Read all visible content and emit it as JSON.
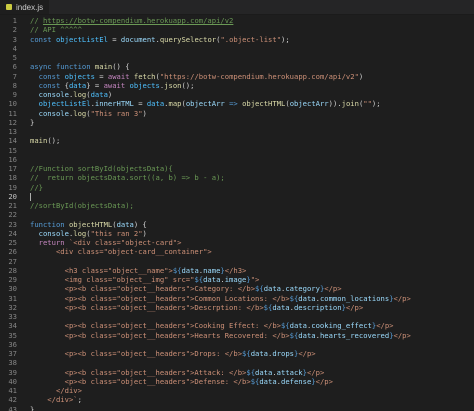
{
  "tab": {
    "filename": "index.js"
  },
  "lines": [
    {
      "n": "1",
      "t": [
        [
          "t-com",
          "// "
        ],
        [
          "t-link",
          "https://botw-compendium.herokuapp.com/api/v2"
        ]
      ]
    },
    {
      "n": "2",
      "t": [
        [
          "t-com",
          "// API ^^^^^"
        ]
      ]
    },
    {
      "n": "3",
      "t": [
        [
          "t-kw",
          "const "
        ],
        [
          "t-const",
          "objectListEl"
        ],
        [
          "t-op",
          " = "
        ],
        [
          "t-var",
          "document"
        ],
        [
          "t-op",
          "."
        ],
        [
          "t-fn",
          "querySelector"
        ],
        [
          "t-op",
          "("
        ],
        [
          "t-str",
          "\".object-list\""
        ],
        [
          "t-op",
          ");"
        ]
      ]
    },
    {
      "n": "4",
      "t": []
    },
    {
      "n": "5",
      "t": []
    },
    {
      "n": "6",
      "t": [
        [
          "t-kw",
          "async "
        ],
        [
          "t-kw",
          "function "
        ],
        [
          "t-fn",
          "main"
        ],
        [
          "t-op",
          "() {"
        ]
      ]
    },
    {
      "n": "7",
      "t": [
        [
          "t-op",
          "  "
        ],
        [
          "t-kw",
          "const "
        ],
        [
          "t-const",
          "objects"
        ],
        [
          "t-op",
          " = "
        ],
        [
          "t-ctrl",
          "await "
        ],
        [
          "t-fn",
          "fetch"
        ],
        [
          "t-op",
          "("
        ],
        [
          "t-str",
          "\"https://botw-compendium.herokuapp.com/api/v2\""
        ],
        [
          "t-op",
          ")"
        ]
      ]
    },
    {
      "n": "8",
      "t": [
        [
          "t-op",
          "  "
        ],
        [
          "t-kw",
          "const "
        ],
        [
          "t-op",
          "{"
        ],
        [
          "t-const",
          "data"
        ],
        [
          "t-op",
          "} = "
        ],
        [
          "t-ctrl",
          "await "
        ],
        [
          "t-const",
          "objects"
        ],
        [
          "t-op",
          "."
        ],
        [
          "t-fn",
          "json"
        ],
        [
          "t-op",
          "();"
        ]
      ]
    },
    {
      "n": "9",
      "t": [
        [
          "t-op",
          "  "
        ],
        [
          "t-var",
          "console"
        ],
        [
          "t-op",
          "."
        ],
        [
          "t-fn",
          "log"
        ],
        [
          "t-op",
          "("
        ],
        [
          "t-const",
          "data"
        ],
        [
          "t-op",
          ")"
        ]
      ]
    },
    {
      "n": "10",
      "t": [
        [
          "t-op",
          "  "
        ],
        [
          "t-const",
          "objectListEl"
        ],
        [
          "t-op",
          "."
        ],
        [
          "t-var",
          "innerHTML"
        ],
        [
          "t-op",
          " = "
        ],
        [
          "t-const",
          "data"
        ],
        [
          "t-op",
          "."
        ],
        [
          "t-fn",
          "map"
        ],
        [
          "t-op",
          "("
        ],
        [
          "t-var",
          "objectArr"
        ],
        [
          "t-kw",
          " => "
        ],
        [
          "t-fn",
          "objectHTML"
        ],
        [
          "t-op",
          "("
        ],
        [
          "t-var",
          "objectArr"
        ],
        [
          "t-op",
          "))."
        ],
        [
          "t-fn",
          "join"
        ],
        [
          "t-op",
          "("
        ],
        [
          "t-str",
          "\"\""
        ],
        [
          "t-op",
          ");"
        ]
      ]
    },
    {
      "n": "11",
      "t": [
        [
          "t-op",
          "  "
        ],
        [
          "t-var",
          "console"
        ],
        [
          "t-op",
          "."
        ],
        [
          "t-fn",
          "log"
        ],
        [
          "t-op",
          "("
        ],
        [
          "t-str",
          "\"This ran 3\""
        ],
        [
          "t-op",
          ")"
        ]
      ]
    },
    {
      "n": "12",
      "t": [
        [
          "t-op",
          "}"
        ]
      ]
    },
    {
      "n": "13",
      "t": []
    },
    {
      "n": "14",
      "t": [
        [
          "t-fn",
          "main"
        ],
        [
          "t-op",
          "();"
        ]
      ]
    },
    {
      "n": "15",
      "t": []
    },
    {
      "n": "16",
      "t": []
    },
    {
      "n": "17",
      "t": [
        [
          "t-com",
          "//Function sortById(objectsData){"
        ]
      ]
    },
    {
      "n": "18",
      "t": [
        [
          "t-com",
          "//  return objectsData.sort((a, b) => b - a);"
        ]
      ]
    },
    {
      "n": "19",
      "t": [
        [
          "t-com",
          "//}"
        ]
      ]
    },
    {
      "n": "20",
      "t": [],
      "current": true
    },
    {
      "n": "21",
      "t": [
        [
          "t-com",
          "//sortById(objectsData);"
        ]
      ]
    },
    {
      "n": "22",
      "t": []
    },
    {
      "n": "23",
      "t": [
        [
          "t-kw",
          "function "
        ],
        [
          "t-fn",
          "objectHTML"
        ],
        [
          "t-op",
          "("
        ],
        [
          "t-var",
          "data"
        ],
        [
          "t-op",
          ") {"
        ]
      ]
    },
    {
      "n": "24",
      "t": [
        [
          "t-op",
          "  "
        ],
        [
          "t-var",
          "console"
        ],
        [
          "t-op",
          "."
        ],
        [
          "t-fn",
          "log"
        ],
        [
          "t-op",
          "("
        ],
        [
          "t-str",
          "\"this ran 2\""
        ],
        [
          "t-op",
          ")"
        ]
      ]
    },
    {
      "n": "25",
      "t": [
        [
          "t-op",
          "  "
        ],
        [
          "t-ctrl",
          "return "
        ],
        [
          "t-str",
          "`<div class=\"object-card\">"
        ]
      ]
    },
    {
      "n": "26",
      "t": [
        [
          "t-str",
          "      <div class=\"object-card__container\">"
        ]
      ]
    },
    {
      "n": "27",
      "t": []
    },
    {
      "n": "28",
      "t": [
        [
          "t-str",
          "        <h3 class=\"object__name\">"
        ],
        [
          "t-kw",
          "${"
        ],
        [
          "t-var",
          "data"
        ],
        [
          "t-op",
          "."
        ],
        [
          "t-var",
          "name"
        ],
        [
          "t-kw",
          "}"
        ],
        [
          "t-str",
          "</h3>"
        ]
      ]
    },
    {
      "n": "29",
      "t": [
        [
          "t-str",
          "        <img class=\"object__img\" src=\""
        ],
        [
          "t-kw",
          "${"
        ],
        [
          "t-var",
          "data"
        ],
        [
          "t-op",
          "."
        ],
        [
          "t-var",
          "image"
        ],
        [
          "t-kw",
          "}"
        ],
        [
          "t-str",
          "\">"
        ]
      ]
    },
    {
      "n": "30",
      "t": [
        [
          "t-str",
          "        <p><b class=\"object__headers\">Category: </b>"
        ],
        [
          "t-kw",
          "${"
        ],
        [
          "t-var",
          "data"
        ],
        [
          "t-op",
          "."
        ],
        [
          "t-var",
          "category"
        ],
        [
          "t-kw",
          "}"
        ],
        [
          "t-str",
          "</p>"
        ]
      ]
    },
    {
      "n": "31",
      "t": [
        [
          "t-str",
          "        <p><b class=\"object__headers\">Common Locations: </b>"
        ],
        [
          "t-kw",
          "${"
        ],
        [
          "t-var",
          "data"
        ],
        [
          "t-op",
          "."
        ],
        [
          "t-var",
          "common_locations"
        ],
        [
          "t-kw",
          "}"
        ],
        [
          "t-str",
          "</p>"
        ]
      ]
    },
    {
      "n": "32",
      "t": [
        [
          "t-str",
          "        <p><b class=\"object__headers\">Descrption: </b>"
        ],
        [
          "t-kw",
          "${"
        ],
        [
          "t-var",
          "data"
        ],
        [
          "t-op",
          "."
        ],
        [
          "t-var",
          "description"
        ],
        [
          "t-kw",
          "}"
        ],
        [
          "t-str",
          "</p>"
        ]
      ]
    },
    {
      "n": "33",
      "t": []
    },
    {
      "n": "34",
      "t": [
        [
          "t-str",
          "        <p><b class=\"object__headers\">Cooking Effect: </b>"
        ],
        [
          "t-kw",
          "${"
        ],
        [
          "t-var",
          "data"
        ],
        [
          "t-op",
          "."
        ],
        [
          "t-var",
          "cooking_effect"
        ],
        [
          "t-kw",
          "}"
        ],
        [
          "t-str",
          "</p>"
        ]
      ]
    },
    {
      "n": "35",
      "t": [
        [
          "t-str",
          "        <p><b class=\"object__headers\">Hearts Recovered: </b>"
        ],
        [
          "t-kw",
          "${"
        ],
        [
          "t-var",
          "data"
        ],
        [
          "t-op",
          "."
        ],
        [
          "t-var",
          "hearts_recovered"
        ],
        [
          "t-kw",
          "}"
        ],
        [
          "t-str",
          "</p>"
        ]
      ]
    },
    {
      "n": "36",
      "t": []
    },
    {
      "n": "37",
      "t": [
        [
          "t-str",
          "        <p><b class=\"object__headers\">Drops: </b>"
        ],
        [
          "t-kw",
          "${"
        ],
        [
          "t-var",
          "data"
        ],
        [
          "t-op",
          "."
        ],
        [
          "t-var",
          "drops"
        ],
        [
          "t-kw",
          "}"
        ],
        [
          "t-str",
          "</p>"
        ]
      ]
    },
    {
      "n": "38",
      "t": []
    },
    {
      "n": "39",
      "t": [
        [
          "t-str",
          "        <p><b class=\"object__headers\">Attack: </b>"
        ],
        [
          "t-kw",
          "${"
        ],
        [
          "t-var",
          "data"
        ],
        [
          "t-op",
          "."
        ],
        [
          "t-var",
          "attack"
        ],
        [
          "t-kw",
          "}"
        ],
        [
          "t-str",
          "</p>"
        ]
      ]
    },
    {
      "n": "40",
      "t": [
        [
          "t-str",
          "        <p><b class=\"object__headers\">Defense: </b>"
        ],
        [
          "t-kw",
          "${"
        ],
        [
          "t-var",
          "data"
        ],
        [
          "t-op",
          "."
        ],
        [
          "t-var",
          "defense"
        ],
        [
          "t-kw",
          "}"
        ],
        [
          "t-str",
          "</p>"
        ]
      ]
    },
    {
      "n": "41",
      "t": [
        [
          "t-str",
          "      </div>"
        ]
      ]
    },
    {
      "n": "42",
      "t": [
        [
          "t-str",
          "    </div>`"
        ],
        [
          "t-op",
          ";"
        ]
      ]
    },
    {
      "n": "43",
      "t": [
        [
          "t-op",
          "}"
        ]
      ]
    }
  ]
}
